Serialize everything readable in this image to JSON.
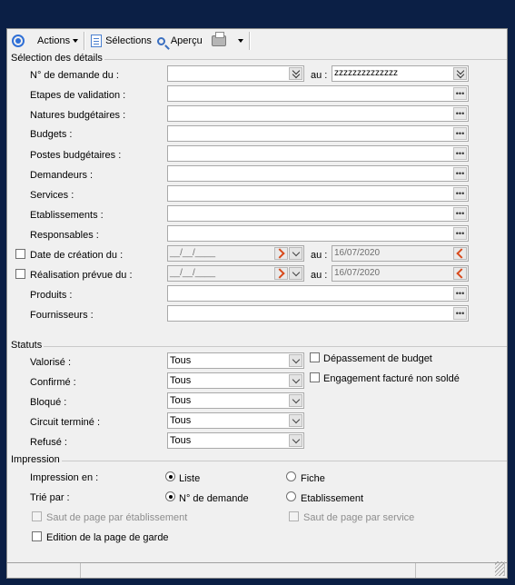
{
  "toolbar": {
    "actions_label": "Actions",
    "selections_label": "Sélections",
    "preview_label": "Aperçu"
  },
  "sections": {
    "details": "Sélection des détails",
    "statuts": "Statuts",
    "impression": "Impression"
  },
  "details": {
    "demande_du_label": "N° de demande du :",
    "demande_au_label": "au :",
    "demande_du_value": "",
    "demande_au_value": "zzzzzzzzzzzzzz",
    "rows": [
      {
        "label": "Etapes de validation :",
        "value": ""
      },
      {
        "label": "Natures budgétaires :",
        "value": ""
      },
      {
        "label": "Budgets :",
        "value": ""
      },
      {
        "label": "Postes budgétaires :",
        "value": ""
      },
      {
        "label": "Demandeurs :",
        "value": ""
      },
      {
        "label": "Services :",
        "value": ""
      },
      {
        "label": "Etablissements :",
        "value": ""
      },
      {
        "label": "Responsables :",
        "value": ""
      }
    ],
    "date_creation": {
      "label": "Date de création du :",
      "from": "__/__/____",
      "au_label": "au :",
      "to": "16/07/2020",
      "checked": false
    },
    "realisation": {
      "label": "Réalisation prévue du :",
      "from": "__/__/____",
      "au_label": "au :",
      "to": "16/07/2020",
      "checked": false
    },
    "produits": {
      "label": "Produits :",
      "value": ""
    },
    "fournisseurs": {
      "label": "Fournisseurs :",
      "value": ""
    }
  },
  "statuts": {
    "rows": [
      {
        "label": "Valorisé :",
        "value": "Tous"
      },
      {
        "label": "Confirmé :",
        "value": "Tous"
      },
      {
        "label": "Bloqué :",
        "value": "Tous"
      },
      {
        "label": "Circuit terminé :",
        "value": "Tous"
      },
      {
        "label": "Refusé :",
        "value": "Tous"
      }
    ],
    "depassement_label": "Dépassement de budget",
    "engagement_label": "Engagement facturé non soldé"
  },
  "impression": {
    "impression_en_label": "Impression en :",
    "option_liste": "Liste",
    "option_fiche": "Fiche",
    "trie_par_label": "Trié par :",
    "option_num_demande": "N° de demande",
    "option_etablissement": "Etablissement",
    "saut_etab_label": "Saut de page par établissement",
    "saut_service_label": "Saut de page par service",
    "edition_garde_label": "Edition de la page de garde",
    "impression_en_selected": "Liste",
    "trie_par_selected": "N° de demande"
  },
  "colors": {
    "background": "#0b1f45",
    "panel": "#f0f0f0",
    "accent_blue": "#2f6fd6",
    "date_button_orange": "#d84a1c"
  },
  "icons": [
    "target-icon",
    "caret-down-icon",
    "document-icon",
    "magnifier-icon",
    "printer-icon",
    "ellipsis-icon",
    "double-chevron-down-icon",
    "chevron-down-icon",
    "arrow-right-icon",
    "arrow-left-icon"
  ]
}
